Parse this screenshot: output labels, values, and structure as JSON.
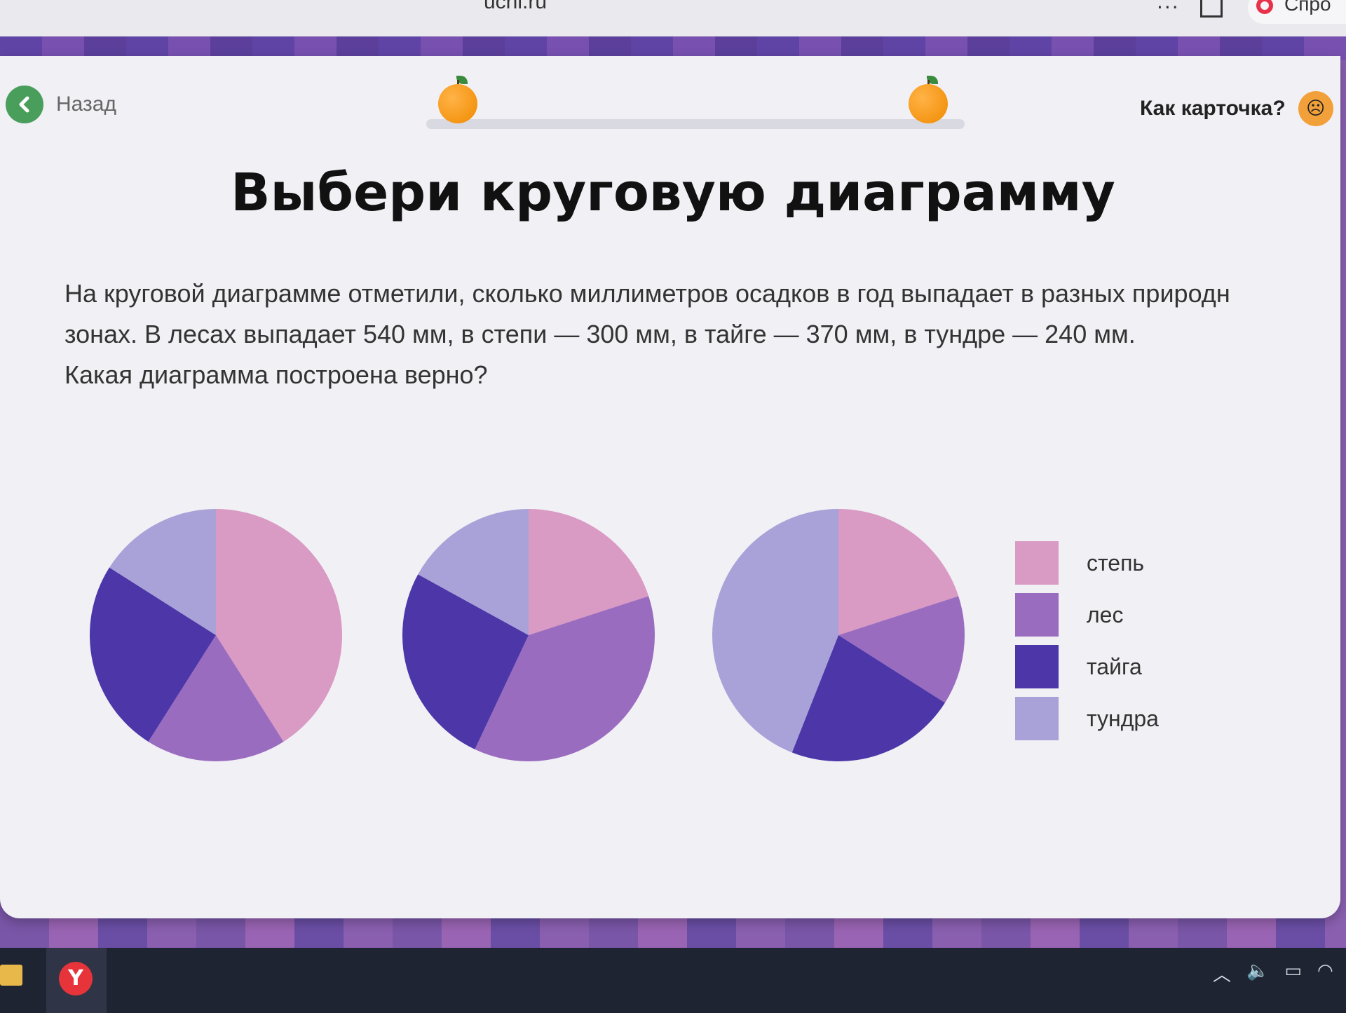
{
  "browser": {
    "url": "uchi.ru",
    "more_glyph": "···",
    "tab_text": "Спро"
  },
  "header": {
    "back_label": "Назад",
    "feedback_label": "Как карточка?"
  },
  "title": "Выбери круговую диаграмму",
  "question": {
    "line1": "На круговой диаграмме отметили, сколько миллиметров осадков в год выпадает в разных природн",
    "line2": "зонах. В лесах выпадает 540 мм, в степи — 300 мм, в тайге — 370 мм, в тундре — 240 мм.",
    "line3": "Какая диаграмма построена верно?"
  },
  "colors": {
    "степь": "#d99ac4",
    "лес": "#9a6cc0",
    "тайга": "#4d36a8",
    "тундра": "#a8a2d8",
    "accent_green": "#4a9e5c",
    "accent_orange": "#f39a1f"
  },
  "legend": [
    {
      "label": "степь",
      "color": "#d99ac4"
    },
    {
      "label": "лес",
      "color": "#9a6cc0"
    },
    {
      "label": "тайга",
      "color": "#4d36a8"
    },
    {
      "label": "тундра",
      "color": "#a8a2d8"
    }
  ],
  "chart_data": [
    {
      "type": "pie",
      "title": "",
      "option": 1,
      "slices": [
        {
          "name": "степь",
          "value": 0.41
        },
        {
          "name": "лес",
          "value": 0.18
        },
        {
          "name": "тайга",
          "value": 0.25
        },
        {
          "name": "тундра",
          "value": 0.16
        }
      ]
    },
    {
      "type": "pie",
      "title": "",
      "option": 2,
      "slices": [
        {
          "name": "степь",
          "value": 0.2
        },
        {
          "name": "лес",
          "value": 0.37
        },
        {
          "name": "тайга",
          "value": 0.26
        },
        {
          "name": "тундра",
          "value": 0.17
        }
      ]
    },
    {
      "type": "pie",
      "title": "",
      "option": 3,
      "slices": [
        {
          "name": "степь",
          "value": 0.2
        },
        {
          "name": "лес",
          "value": 0.14
        },
        {
          "name": "тайга",
          "value": 0.22
        },
        {
          "name": "тундра",
          "value": 0.44
        }
      ]
    }
  ]
}
